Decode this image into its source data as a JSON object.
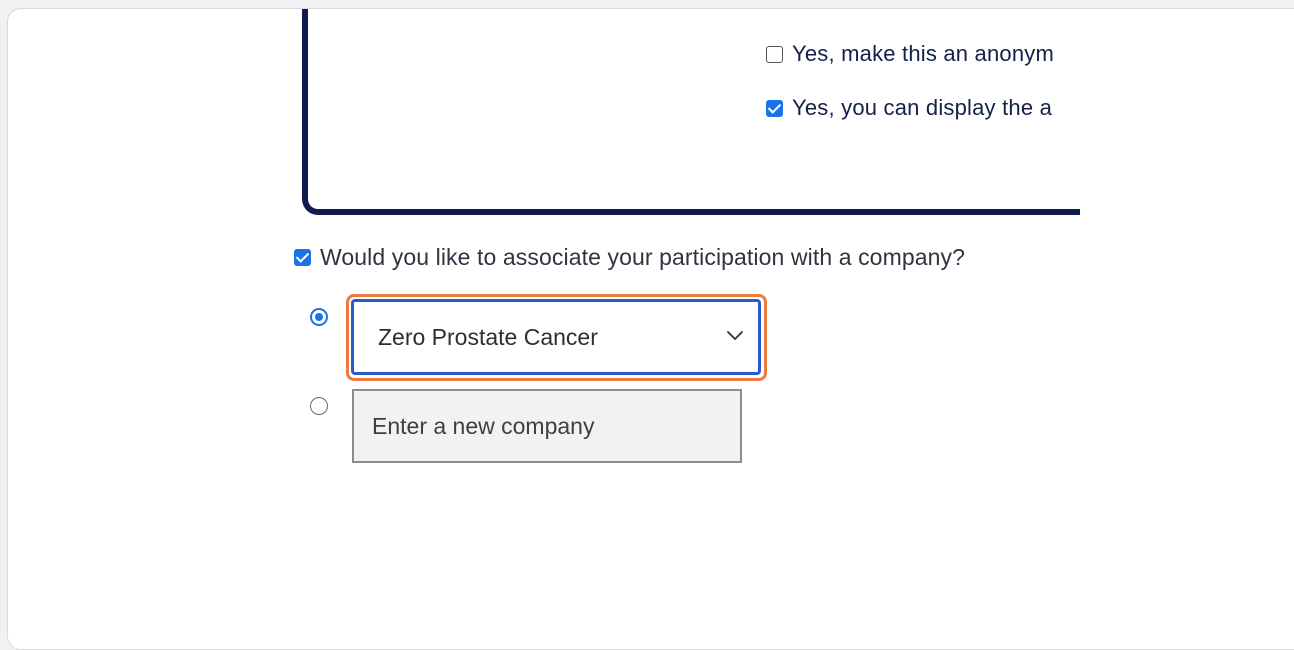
{
  "consent": {
    "anonymous": {
      "label": "Yes, make this an anonym",
      "checked": false
    },
    "display": {
      "label": "Yes, you can display the a",
      "checked": true
    }
  },
  "company_association": {
    "label": "Would you like to associate your participation with a company?",
    "checked": true,
    "existing_option": {
      "selected": true,
      "value": "Zero Prostate Cancer"
    },
    "new_option": {
      "selected": false,
      "placeholder": "Enter a new company",
      "value": ""
    }
  },
  "colors": {
    "panel_border": "#0f1c4d",
    "accent": "#1a73e8",
    "focus_ring": "#2a5ccf",
    "highlight": "#f07a3e"
  },
  "icons": {
    "dropdown": "chevron-down-icon"
  }
}
